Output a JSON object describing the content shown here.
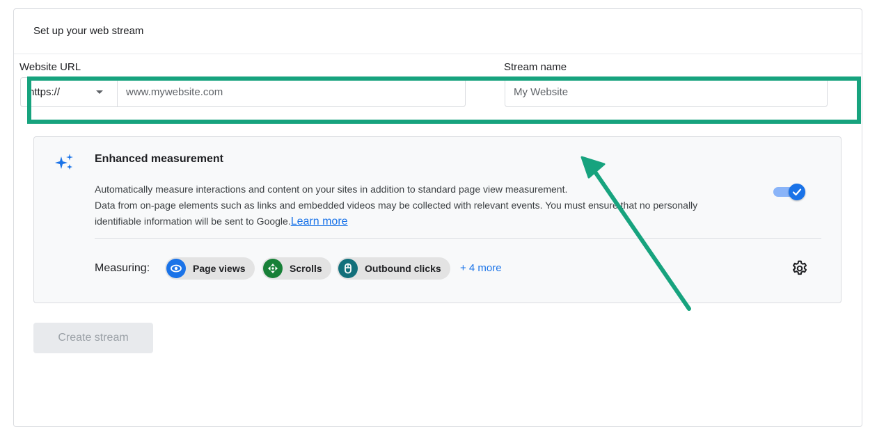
{
  "card": {
    "title": "Set up your web stream"
  },
  "url_field": {
    "label": "Website URL",
    "protocol": "https://",
    "placeholder": "www.mywebsite.com"
  },
  "name_field": {
    "label": "Stream name",
    "placeholder": "My Website"
  },
  "enhanced_measurement": {
    "title": "Enhanced measurement",
    "description_line1": "Automatically measure interactions and content on your sites in addition to standard page view measurement.",
    "description_line2": "Data from on-page elements such as links and embedded videos may be collected with relevant events. You must ensure that no personally",
    "description_line3": "identifiable information will be sent to Google.",
    "learn_more": "Learn more",
    "toggle_on": true,
    "measuring_label": "Measuring:",
    "chips": [
      {
        "label": "Page views",
        "icon": "eye-icon",
        "color": "#1a73e8"
      },
      {
        "label": "Scrolls",
        "icon": "scroll-arrows-icon",
        "color": "#188038"
      },
      {
        "label": "Outbound clicks",
        "icon": "mouse-icon",
        "color": "#12707b"
      }
    ],
    "more": "+ 4 more"
  },
  "buttons": {
    "create": "Create stream"
  },
  "colors": {
    "annotation": "#17a37e",
    "accent": "#1a73e8"
  }
}
